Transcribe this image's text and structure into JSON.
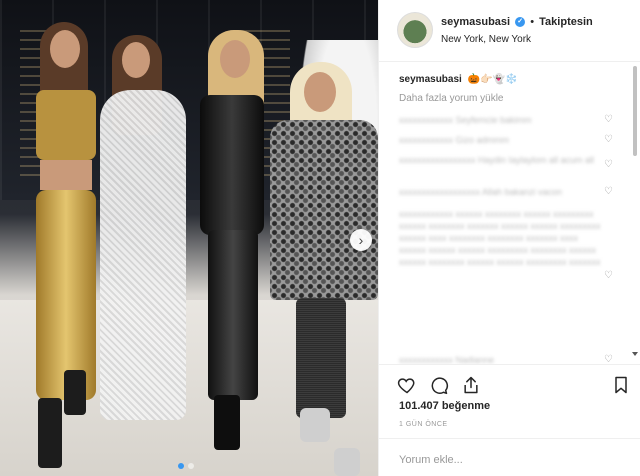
{
  "post": {
    "username": "seymasubasi",
    "follow_status": "Takiptesin",
    "separator": "•",
    "verified_glyph": "✓",
    "location": "New York, New York",
    "caption_emojis": "🎃👉🏻👻❄️",
    "load_more": "Daha fazla yorum yükle",
    "likes": "101.407",
    "likes_label": "beğenme",
    "time": "1 GÜN ÖNCE",
    "comment_placeholder": "Yorum ekle..."
  },
  "comments": [
    {
      "text": "xxxxxxxxxxxx Seyfemcie bakimm"
    },
    {
      "text": "xxxxxxxxxxxx Gizo admmm"
    },
    {
      "text": "xxxxxxxxxxxxxxxxx Haydin Iaylaylom all acum all"
    },
    {
      "text": "xxxxxxxxxxxxxxxxxx Allah bakanzi vacon"
    },
    {
      "text": "xxxxxxxxxxxx xxxxxx xxxxxxxx xxxxxx xxxxxxxxx xxxxxx xxxxxxxx xxxxxxx xxxxxx xxxxxx xxxxxxxxx xxxxxx xxxx xxxxxxxx xxxxxxxx xxxxxxx xxxx xxxxxx xxxxxx xxxxxx xxxxxxxxx xxxxxxxx xxxxxx xxxxxx xxxxxxxx xxxxxx xxxxxx xxxxxxxxx xxxxxxx"
    },
    {
      "text": "xxxxxxxxxxxx Nadianne"
    }
  ],
  "icons": {
    "heart": "heart-icon",
    "comment": "comment-icon",
    "share": "share-icon",
    "save": "bookmark-icon",
    "next": "chevron-right-icon"
  },
  "colors": {
    "link_blue": "#3897f0",
    "text": "#262626",
    "muted": "#999999"
  }
}
